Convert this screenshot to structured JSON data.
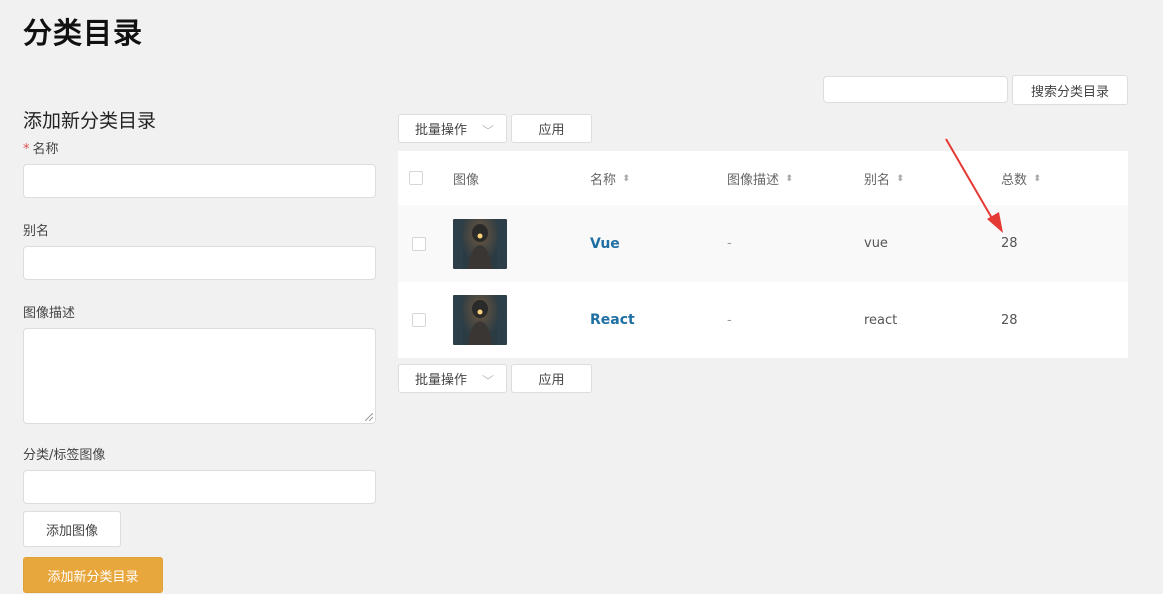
{
  "page": {
    "title": "分类目录"
  },
  "form": {
    "heading": "添加新分类目录",
    "required_mark": "*",
    "name_label": "名称",
    "slug_label": "别名",
    "desc_label": "图像描述",
    "image_label": "分类/标签图像",
    "add_image_button": "添加图像",
    "submit_button": "添加新分类目录"
  },
  "search": {
    "button": "搜索分类目录"
  },
  "bulk": {
    "select_label": "批量操作",
    "apply_button": "应用"
  },
  "table": {
    "columns": {
      "image": "图像",
      "name": "名称",
      "description": "图像描述",
      "slug": "别名",
      "count": "总数"
    },
    "rows": [
      {
        "name": "Vue",
        "description": "-",
        "slug": "vue",
        "count": "28"
      },
      {
        "name": "React",
        "description": "-",
        "slug": "react",
        "count": "28"
      }
    ]
  },
  "colors": {
    "primary_button": "#e8a73d",
    "link": "#1f6fa3",
    "annotation_arrow": "#e53935"
  },
  "icons": {
    "sort": "sort-icon",
    "chevron": "chevron-down-icon"
  }
}
